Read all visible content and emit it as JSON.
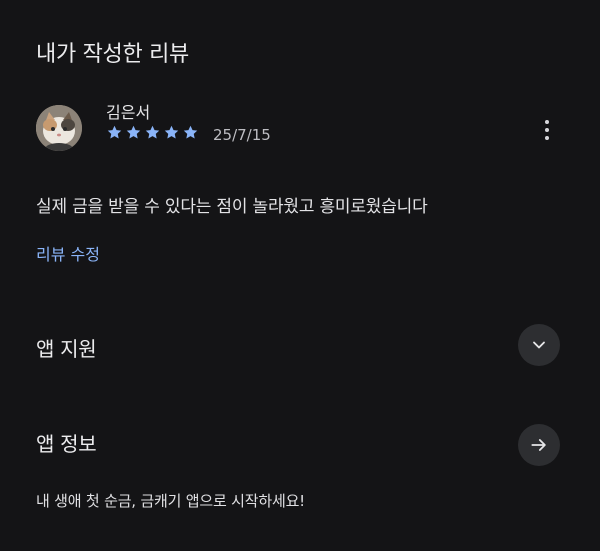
{
  "section": {
    "title": "내가 작성한 리뷰"
  },
  "review": {
    "avatar_icon": "cat-avatar-icon",
    "author": "김은서",
    "rating": 5,
    "rating_max": 5,
    "star_color": "#8ab4f8",
    "date": "25/7/15",
    "more_icon": "more-vert-icon",
    "text": "실제 금을 받을 수 있다는 점이 놀라웠고 흥미로웠습니다",
    "edit_label": "리뷰 수정"
  },
  "app_support": {
    "title": "앱 지원",
    "icon": "chevron-down-icon"
  },
  "app_info": {
    "title": "앱 정보",
    "icon": "arrow-right-icon",
    "description": "내 생애 첫 순금, 금캐기 앱으로 시작하세요!"
  },
  "colors": {
    "background": "#141416",
    "accent": "#8ab4f8",
    "button_bg": "#2d2e31"
  }
}
